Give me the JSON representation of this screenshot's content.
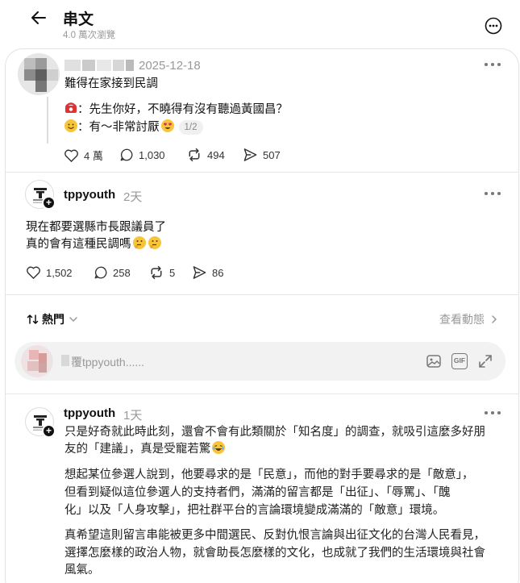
{
  "header": {
    "title": "串文",
    "views": "4.0 萬次瀏覽"
  },
  "original_post": {
    "timestamp": "2025-12-18",
    "lines": [
      "難得在家接到民調",
      "：先生你好，不曉得有沒有聽過黃國昌？",
      "：有～非常討厭"
    ],
    "pager": "1/2",
    "likes": "4 萬",
    "comments": "1,030",
    "reposts": "494",
    "shares": "507"
  },
  "reply_post": {
    "username": "tppyouth",
    "time_ago": "2天",
    "lines": [
      "現在都要選縣市長跟議員了",
      "真的會有這種民調嗎"
    ],
    "likes": "1,502",
    "comments": "258",
    "reposts": "5",
    "shares": "86"
  },
  "sort_bar": {
    "sort_label": "熱門",
    "activity_label": "查看動態"
  },
  "reply_input": {
    "placeholder": "覆tppyouth......",
    "gif_label": "GIF"
  },
  "comment": {
    "username": "tppyouth",
    "time_ago": "1天",
    "paragraphs": [
      [
        "只是好奇就此時此刻，還會不會有此類關於「知名度」的調查，就吸引這麼多好朋",
        "友的「建議」，真是受寵若驚"
      ],
      [
        "想起某位參選人說到，他要尋求的是「民意」，而他的對手要尋求的是「敵意」，",
        "但看到疑似這位參選人的支持者們，滿滿的留言都是「出征」、「辱罵」、「醜",
        "化」以及「人身攻擊」，把社群平台的言論環境變成滿滿的「敵意」環境。"
      ],
      [
        "真希望這則留言串能被更多中間選民、反對仇恨言論與出征文化的台灣人民看見，",
        "選擇怎麼樣的政治人物，就會助長怎麼樣的文化，也成就了我們的生活環境與社會",
        "風氣。"
      ]
    ]
  },
  "icons": {
    "back": "arrow-left-icon",
    "more": "more-horizontal-circle-icon",
    "heart": "heart-icon",
    "comment": "comment-bubble-icon",
    "repost": "repost-icon",
    "share": "send-icon",
    "sort": "sort-arrows-icon",
    "image": "image-icon",
    "gif": "gif-icon",
    "expand": "expand-icon",
    "phone": "telephone-emoji",
    "smile": "smiling-face-emoji",
    "heart_eyes": "heart-eyes-emoji",
    "thinking": "thinking-face-emoji",
    "laugh": "laughing-emoji"
  }
}
